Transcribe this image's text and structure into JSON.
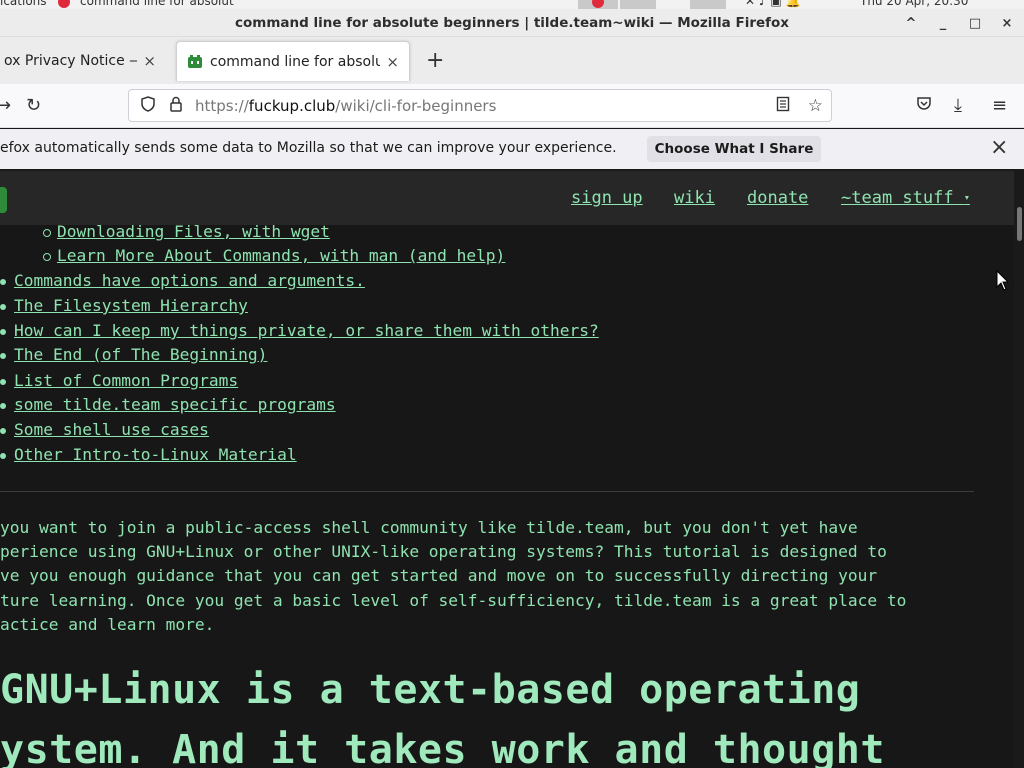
{
  "os_panel": {
    "snippet_left": "ications",
    "snippet_mid": "command line for absolut",
    "clock": "Thu 20 Apr, 20:30"
  },
  "window": {
    "title": "command line for absolute beginners | tilde.team~wiki — Mozilla Firefox",
    "controls": [
      "^",
      "_",
      "□",
      "×"
    ]
  },
  "tabs": [
    {
      "label": "ox Privacy Notice — |",
      "close": "×",
      "active": false
    },
    {
      "label": "command line for absolu",
      "close": "×",
      "active": true
    }
  ],
  "new_tab_label": "+",
  "nav": {
    "back_icon": "back-arrow-icon",
    "reload_icon": "reload-icon",
    "url_prefix": "https://",
    "url_domain": "fuckup.club",
    "url_path": "/wiki/cli-for-beginners"
  },
  "notification": {
    "message": "efox automatically sends some data to Mozilla so that we can improve your experience.",
    "button": "Choose What I Share",
    "close": "×"
  },
  "site_nav": {
    "links": [
      "sign up",
      "wiki",
      "donate",
      "~team stuff"
    ],
    "dropdown_caret": "▾"
  },
  "toc_sub": [
    "Downloading Files, with wget",
    "Learn More About Commands, with man (and help)"
  ],
  "toc": [
    "Commands have options and arguments.",
    "The Filesystem Hierarchy",
    "How can I keep my things private, or share them with others?",
    "The End (of The Beginning)",
    "List of Common Programs",
    "some tilde.team specific programs",
    "Some shell use cases",
    "Other Intro-to-Linux Material"
  ],
  "intro_lines": [
    " you want to join a public-access shell community like tilde.team, but you don't yet have",
    "perience using GNU+Linux or other UNIX-like operating systems? This tutorial is designed to",
    "ve you enough guidance that you can get started and move on to successfully directing your",
    "ture learning. Once you get a basic level of self-sufficiency, tilde.team is a great place to",
    "actice and learn more."
  ],
  "heading_lines": [
    "GNU+Linux is a text-based operating",
    "ystem. And it takes work and thought"
  ]
}
